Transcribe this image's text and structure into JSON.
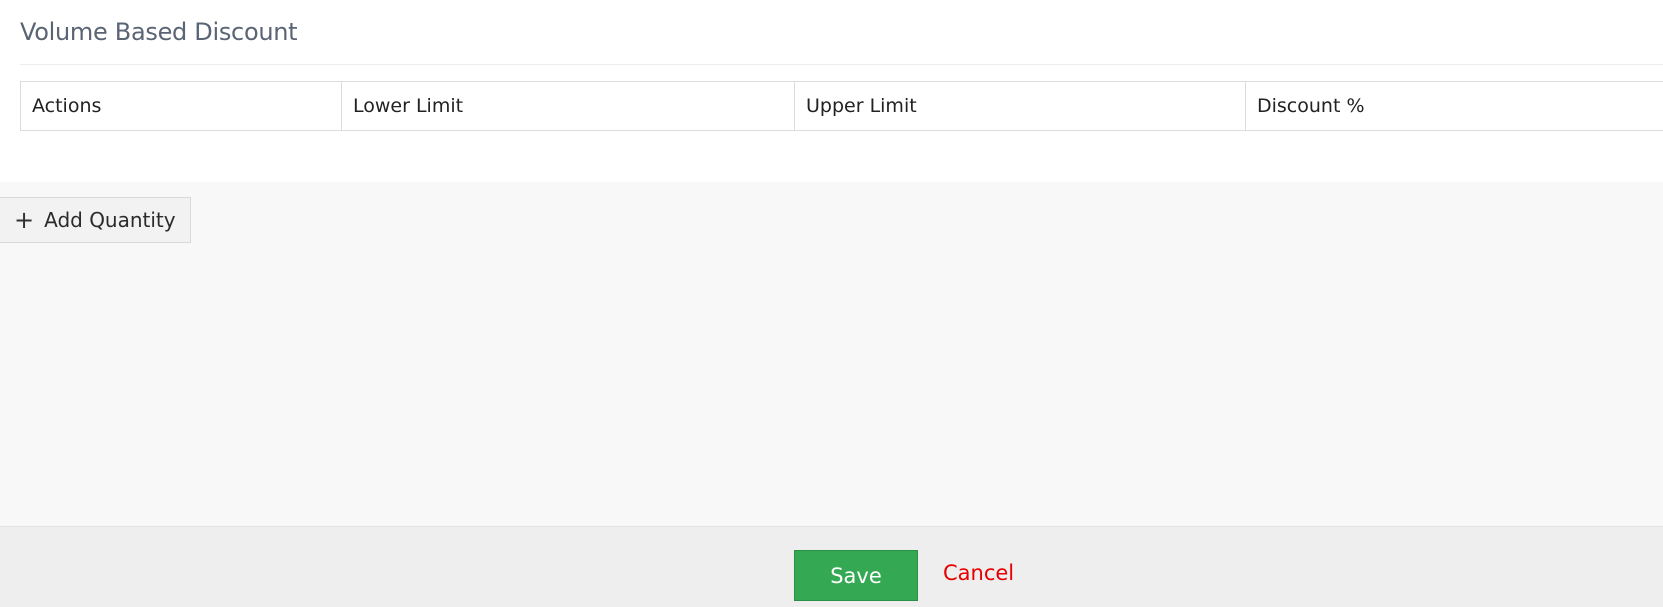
{
  "section": {
    "title": "Volume Based Discount"
  },
  "table": {
    "columns": [
      "Actions",
      "Lower Limit",
      "Upper Limit",
      "Discount %"
    ]
  },
  "add_quantity": {
    "icon": "plus-icon",
    "label": "Add Quantity"
  },
  "footer": {
    "save_label": "Save",
    "cancel_label": "Cancel"
  },
  "colors": {
    "save_button": "#34a853",
    "cancel_link": "#e60000",
    "title_text": "#5a6475"
  }
}
